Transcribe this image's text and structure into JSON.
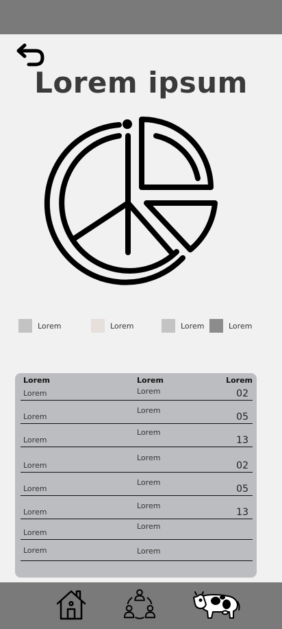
{
  "header": {
    "title": "Lorem ipsum"
  },
  "icons": {
    "back": "undo-arrow-icon",
    "chart": "pie-chart-icon",
    "nav_home": "house-icon",
    "nav_community": "people-cycle-icon",
    "nav_cow": "cow-icon"
  },
  "legend": [
    {
      "label": "Lorem",
      "color": "#c3c3c3"
    },
    {
      "label": "Lorem",
      "color": "#e6dfdb"
    },
    {
      "label": "Lorem",
      "color": "#c4c4c4"
    },
    {
      "label": "Lorem",
      "color": "#8c8c8c"
    }
  ],
  "table": {
    "headers": [
      "Lorem",
      "Lorem",
      "Lorem"
    ],
    "rows": [
      {
        "a": "Lorem",
        "b": "Lorem",
        "c": "02"
      },
      {
        "a": "Lorem",
        "b": "Lorem",
        "c": "05"
      },
      {
        "a": "Lorem",
        "b": "Lorem",
        "c": "13"
      },
      {
        "a": "Lorem",
        "b": "Lorem",
        "c": "02"
      },
      {
        "a": "Lorem",
        "b": "Lorem",
        "c": "05"
      },
      {
        "a": "Lorem",
        "b": "Lorem",
        "c": "13"
      },
      {
        "a": "Lorem",
        "b": "Lorem",
        "c": ""
      },
      {
        "a": "Lorem",
        "b": "Lorem",
        "c": ""
      }
    ]
  },
  "colors": {
    "bars": "#7a7a7a",
    "background": "#f1f1f1",
    "table_card": "#bcbdc0",
    "title": "#3a3a3a"
  }
}
